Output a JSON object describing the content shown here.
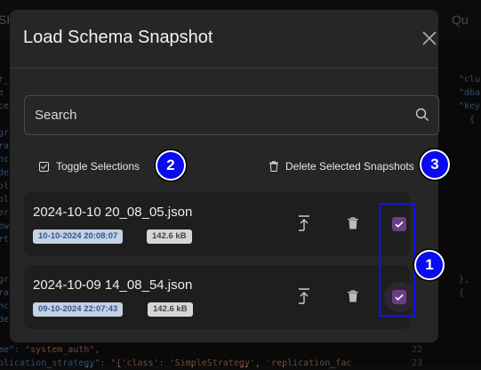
{
  "background": {
    "topbar_left": "SH",
    "topbar_right": "Qu",
    "code_left": [
      "r_",
      "e",
      "ce",
      "",
      "gr",
      "ra",
      "nc",
      "de",
      "ol",
      "ol",
      "er",
      "ew",
      "rt",
      "",
      "",
      "gr",
      "ra",
      "nc",
      "de"
    ],
    "code_right": [
      "\"clu",
      "\"dba",
      "\"key",
      "  {",
      "",
      "",
      "",
      "",
      "",
      "",
      "",
      "",
      "",
      "",
      "",
      "},",
      "{"
    ],
    "bottom_lines": [
      {
        "key": "me\"",
        "value": "\"system_auth\","
      },
      {
        "key": "plication_strategy\"",
        "value": "\"{'class': 'SimpleStrategy', 'replication_fac"
      }
    ],
    "line_numbers": [
      "22",
      "23"
    ]
  },
  "modal": {
    "title": "Load Schema Snapshot",
    "search_placeholder": "Search",
    "toggle_label": "Toggle Selections",
    "delete_selected_label": "Delete Selected Snapshots",
    "snapshots": [
      {
        "name": "2024-10-10 20_08_05.json",
        "date": "10-10-2024 20:08:07",
        "size": "142.6 kB",
        "selected": true
      },
      {
        "name": "2024-10-09 14_08_54.json",
        "date": "09-10-2024 22:07:43",
        "size": "142.6 kB",
        "selected": true
      }
    ]
  },
  "markers": [
    "1",
    "2",
    "3"
  ],
  "colors": {
    "accent": "#6d3d84",
    "marker": "#0a0af0"
  }
}
